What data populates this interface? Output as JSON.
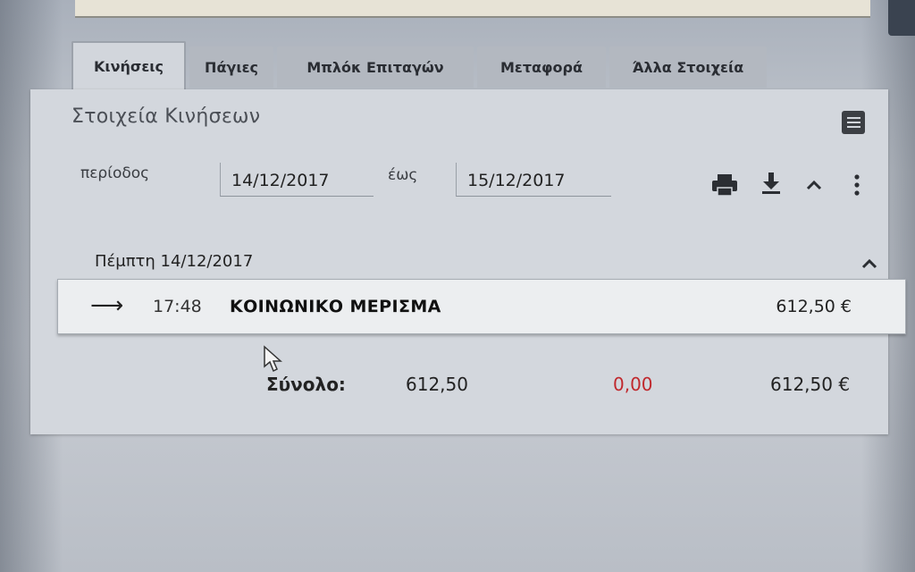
{
  "tabs": [
    {
      "label": "Κινήσεις",
      "active": true
    },
    {
      "label": "Πάγιες",
      "active": false
    },
    {
      "label": "Μπλόκ Επιταγών",
      "active": false
    },
    {
      "label": "Μεταφορά",
      "active": false
    },
    {
      "label": "Άλλα Στοιχεία",
      "active": false
    }
  ],
  "panel": {
    "title": "Στοιχεία Κινήσεων"
  },
  "filter": {
    "period_label": "περίοδος",
    "from_date": "14/12/2017",
    "to_label": "έως",
    "to_date": "15/12/2017"
  },
  "toolbar": {
    "icons": [
      "print-icon",
      "download-icon",
      "chevron-up-icon",
      "more-vertical-icon"
    ]
  },
  "group": {
    "date_header": "Πέμπτη 14/12/2017"
  },
  "transactions": [
    {
      "icon": "arrow-right-icon",
      "time": "17:48",
      "description": "ΚΟΙΝΩΝΙΚΟ ΜΕΡΙΣΜΑ",
      "amount": "612,50 €"
    }
  ],
  "totals": {
    "label": "Σύνολο:",
    "credit": "612,50",
    "debit": "0,00",
    "balance": "612,50 €",
    "debit_color": "#c0282d"
  }
}
